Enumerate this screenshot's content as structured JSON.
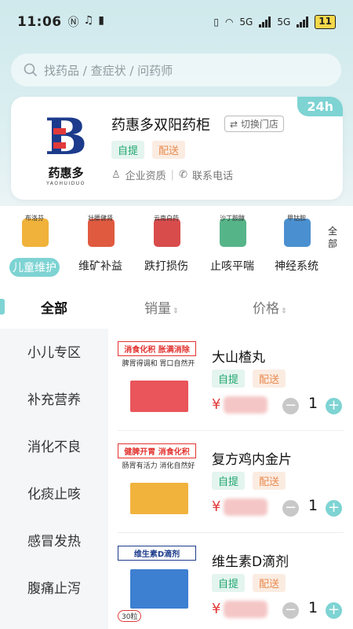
{
  "status_bar": {
    "time": "11:06",
    "network_a": "5G",
    "network_b": "5G",
    "battery": "11"
  },
  "search": {
    "placeholder": "找药品 / 查症状 / 问药师"
  },
  "store": {
    "logo_text": "药惠多",
    "logo_pinyin": "YAOHUIDUO",
    "name": "药惠多双阳药柜",
    "switch_label": "切换门店",
    "badge": "24h",
    "tags": [
      "自提",
      "配送"
    ],
    "qualification": "企业资质",
    "phone": "联系电话"
  },
  "categories": {
    "items": [
      {
        "label": "儿童维护",
        "thumb": "布洛芬",
        "color": "#f0b23a",
        "active": true
      },
      {
        "label": "维矿补益",
        "thumb": "壮腰健肾",
        "color": "#e05a40"
      },
      {
        "label": "跌打损伤",
        "thumb": "云南白药",
        "color": "#d84c4c"
      },
      {
        "label": "止咳平喘",
        "thumb": "沙丁胺醇",
        "color": "#56b489"
      },
      {
        "label": "神经系统",
        "thumb": "甲钴胺",
        "color": "#4a90d0"
      }
    ],
    "all_label": "全部"
  },
  "sort": {
    "all": "全部",
    "sales": "销量",
    "price": "价格"
  },
  "left_nav": [
    "小儿专区",
    "补充营养",
    "消化不良",
    "化痰止咳",
    "感冒发热",
    "腹痛止泻"
  ],
  "products": [
    {
      "name": "大山楂丸",
      "banner": "消食化积 胀满消除",
      "sub": "脾胃得调和 胃口自然开",
      "pack_color": "#e9555a",
      "tags": [
        "自提",
        "配送"
      ],
      "currency": "¥",
      "qty": "1"
    },
    {
      "name": "复方鸡内金片",
      "banner": "健脾开胃 消食化积",
      "sub": "肠胃有活力 消化自然好",
      "pack_color": "#f2b33d",
      "tags": [
        "自提",
        "配送"
      ],
      "currency": "¥",
      "qty": "1"
    },
    {
      "name": "维生素D滴剂",
      "banner": "维生素D滴剂",
      "sub": "30粒",
      "pack_color": "#3d7fd1",
      "tags": [
        "自提",
        "配送"
      ],
      "currency": "¥",
      "qty": "1"
    }
  ]
}
